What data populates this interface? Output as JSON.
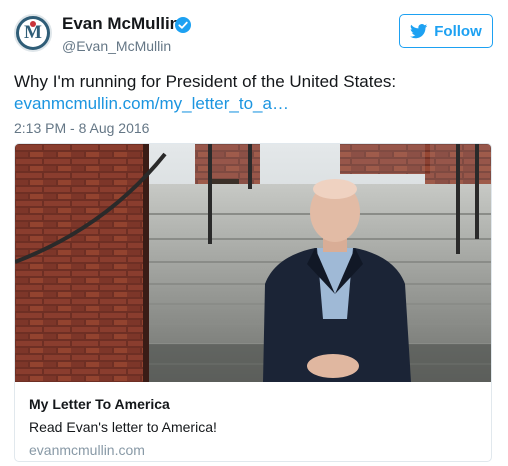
{
  "author": {
    "name": "Evan McMullin",
    "handle": "@Evan_McMullin",
    "avatar_letter": "M",
    "verified": true
  },
  "follow_button": {
    "label": "Follow",
    "icon": "twitter-bird-icon"
  },
  "tweet": {
    "text": "Why I'm running for President of the United States:",
    "link": "evanmcmullin.com/my_letter_to_a…",
    "timestamp": "2:13 PM - 8 Aug 2016"
  },
  "card": {
    "image": "photo-man-sitting-on-stone-steps",
    "title": "My Letter To America",
    "description": "Read Evan's letter to America!",
    "domain": "evanmcmullin.com"
  },
  "colors": {
    "accent": "#1da1f2",
    "link": "#1b95e0",
    "muted": "#657786",
    "brand_logo": "#2f5d77"
  }
}
